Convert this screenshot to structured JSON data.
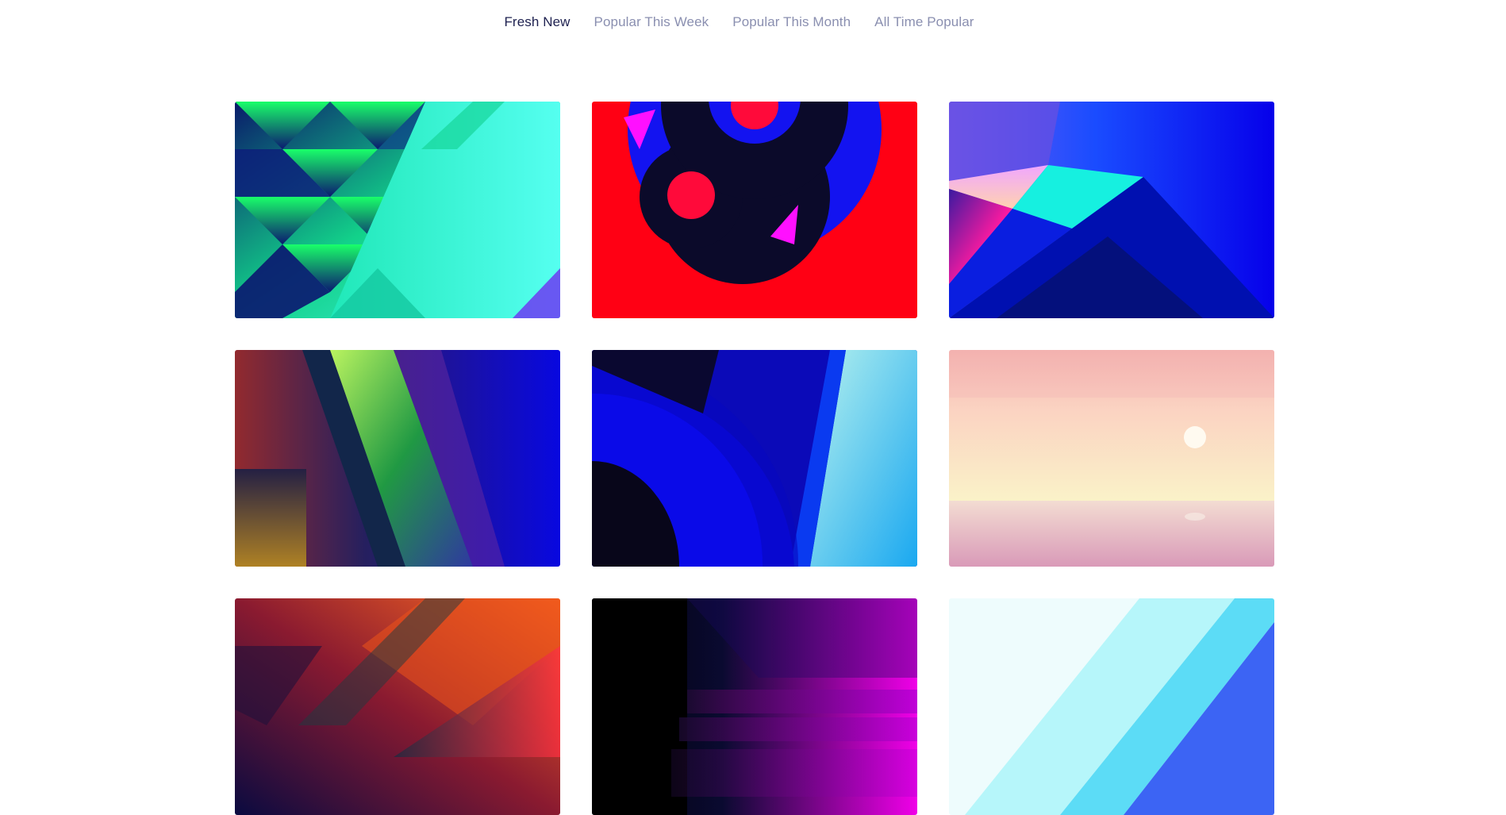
{
  "tabs": [
    {
      "label": "Fresh New",
      "active": true
    },
    {
      "label": "Popular This Week",
      "active": false
    },
    {
      "label": "Popular This Month",
      "active": false
    },
    {
      "label": "All Time Popular",
      "active": false
    }
  ],
  "colors": {
    "tab_active": "#1e2150",
    "tab_inactive": "#8a8fb0"
  }
}
